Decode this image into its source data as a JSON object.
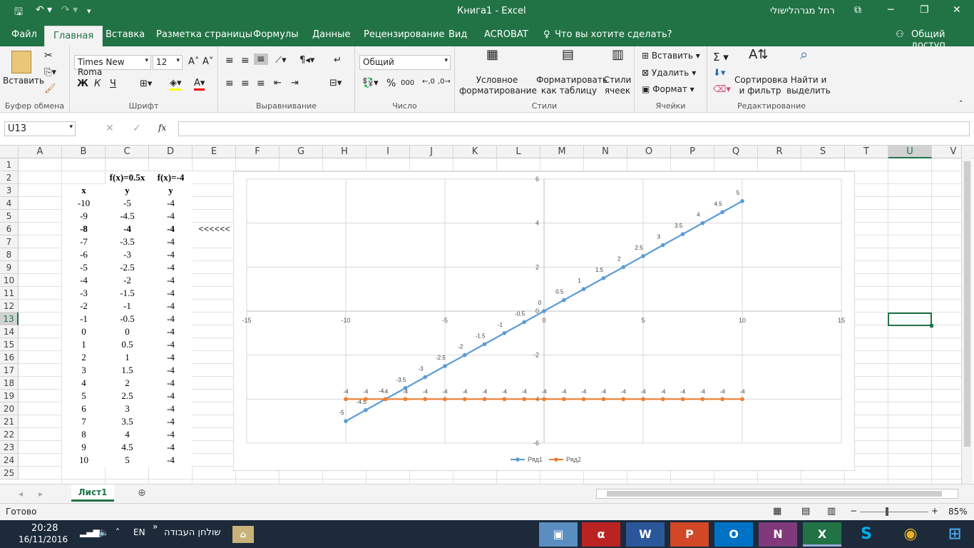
{
  "window": {
    "title": "Книга1  -  Excel",
    "user": "רחל מגרהלישולי"
  },
  "tabs": [
    "Файл",
    "Главная",
    "Вставка",
    "Разметка страницы",
    "Формулы",
    "Данные",
    "Рецензирование",
    "Вид",
    "ACROBAT"
  ],
  "tell_me": "Что вы хотите сделать?",
  "share": "Общий доступ",
  "ribbon": {
    "paste": "Вставить",
    "clipboard": "Буфер обмена",
    "font_name": "Times New Roma",
    "font_size": "12",
    "bold": "Ж",
    "italic": "К",
    "underline": "Ч",
    "font_group": "Шрифт",
    "align_group": "Выравнивание",
    "number_format": "Общий",
    "percent": "%",
    "thousands": "000",
    "number_group": "Число",
    "cond_format_1": "Условное",
    "cond_format_2": "форматирование",
    "format_table_1": "Форматировать",
    "format_table_2": "как таблицу",
    "cell_styles_1": "Стили",
    "cell_styles_2": "ячеек",
    "styles_group": "Стили",
    "insert": "Вставить",
    "delete": "Удалить",
    "format": "Формат",
    "cells_group": "Ячейки",
    "sort_1": "Сортировка",
    "sort_2": "и фильтр",
    "find_1": "Найти и",
    "find_2": "выделить",
    "editing_group": "Редактирование"
  },
  "formula_bar": {
    "name_box": "U13",
    "fx": "fx",
    "value": ""
  },
  "columns": [
    "A",
    "B",
    "C",
    "D",
    "E",
    "F",
    "G",
    "H",
    "I",
    "J",
    "K",
    "L",
    "M",
    "N",
    "O",
    "P",
    "Q",
    "R",
    "S",
    "T",
    "U",
    "V"
  ],
  "rows": [
    "1",
    "2",
    "3",
    "4",
    "5",
    "6",
    "7",
    "8",
    "9",
    "10",
    "11",
    "12",
    "13",
    "14",
    "15",
    "16",
    "17",
    "18",
    "19",
    "20",
    "21",
    "22",
    "23",
    "24",
    "25"
  ],
  "headers": {
    "c2": "f(x)=0.5x",
    "d2": "f(x)=-4",
    "b3": "x",
    "c3": "y",
    "d3": "y"
  },
  "arrow_note": "<<<<<<",
  "table_x": [
    "-10",
    "-9",
    "-8",
    "-7",
    "-6",
    "-5",
    "-4",
    "-3",
    "-2",
    "-1",
    "0",
    "1",
    "2",
    "3",
    "4",
    "5",
    "6",
    "7",
    "8",
    "9",
    "10"
  ],
  "table_y1": [
    "-5",
    "-4.5",
    "-4",
    "-3.5",
    "-3",
    "-2.5",
    "-2",
    "-1.5",
    "-1",
    "-0.5",
    "0",
    "0.5",
    "1",
    "1.5",
    "2",
    "2.5",
    "3",
    "3.5",
    "4",
    "4.5",
    "5"
  ],
  "table_y2": [
    "-4",
    "-4",
    "-4",
    "-4",
    "-4",
    "-4",
    "-4",
    "-4",
    "-4",
    "-4",
    "-4",
    "-4",
    "-4",
    "-4",
    "-4",
    "-4",
    "-4",
    "-4",
    "-4",
    "-4",
    "-4"
  ],
  "chart_data": {
    "type": "scatter",
    "title": "",
    "xlim": [
      -15,
      15
    ],
    "ylim": [
      -6,
      6
    ],
    "x_ticks": [
      "-15",
      "-10",
      "-5",
      "0",
      "5",
      "10",
      "15"
    ],
    "y_ticks": [
      "6",
      "4",
      "2",
      "0",
      "-2",
      "-4",
      "-6"
    ],
    "grid": true,
    "legend": "bottom",
    "series": [
      {
        "name": "Ряд1",
        "color": "#5b9bd5",
        "x": [
          -10,
          -9,
          -8,
          -7,
          -6,
          -5,
          -4,
          -3,
          -2,
          -1,
          0,
          1,
          2,
          3,
          4,
          5,
          6,
          7,
          8,
          9,
          10
        ],
        "y": [
          -5,
          -4.5,
          -4,
          -3.5,
          -3,
          -2.5,
          -2,
          -1.5,
          -1,
          -0.5,
          0,
          0.5,
          1,
          1.5,
          2,
          2.5,
          3,
          3.5,
          4,
          4.5,
          5
        ]
      },
      {
        "name": "Ряд2",
        "color": "#ed7d31",
        "x": [
          -10,
          -9,
          -8,
          -7,
          -6,
          -5,
          -4,
          -3,
          -2,
          -1,
          0,
          1,
          2,
          3,
          4,
          5,
          6,
          7,
          8,
          9,
          10
        ],
        "y": [
          -4,
          -4,
          -4,
          -4,
          -4,
          -4,
          -4,
          -4,
          -4,
          -4,
          -4,
          -4,
          -4,
          -4,
          -4,
          -4,
          -4,
          -4,
          -4,
          -4,
          -4
        ]
      }
    ]
  },
  "sheet_tab": "Лист1",
  "status": {
    "ready": "Готово",
    "zoom": "85%"
  },
  "taskbar": {
    "time": "20:28",
    "date": "16/11/2016",
    "lang": "EN",
    "desktop": "שולחן העבודה"
  },
  "colors": {
    "excel_green": "#217346",
    "series1": "#5b9bd5",
    "series2": "#ed7d31"
  }
}
